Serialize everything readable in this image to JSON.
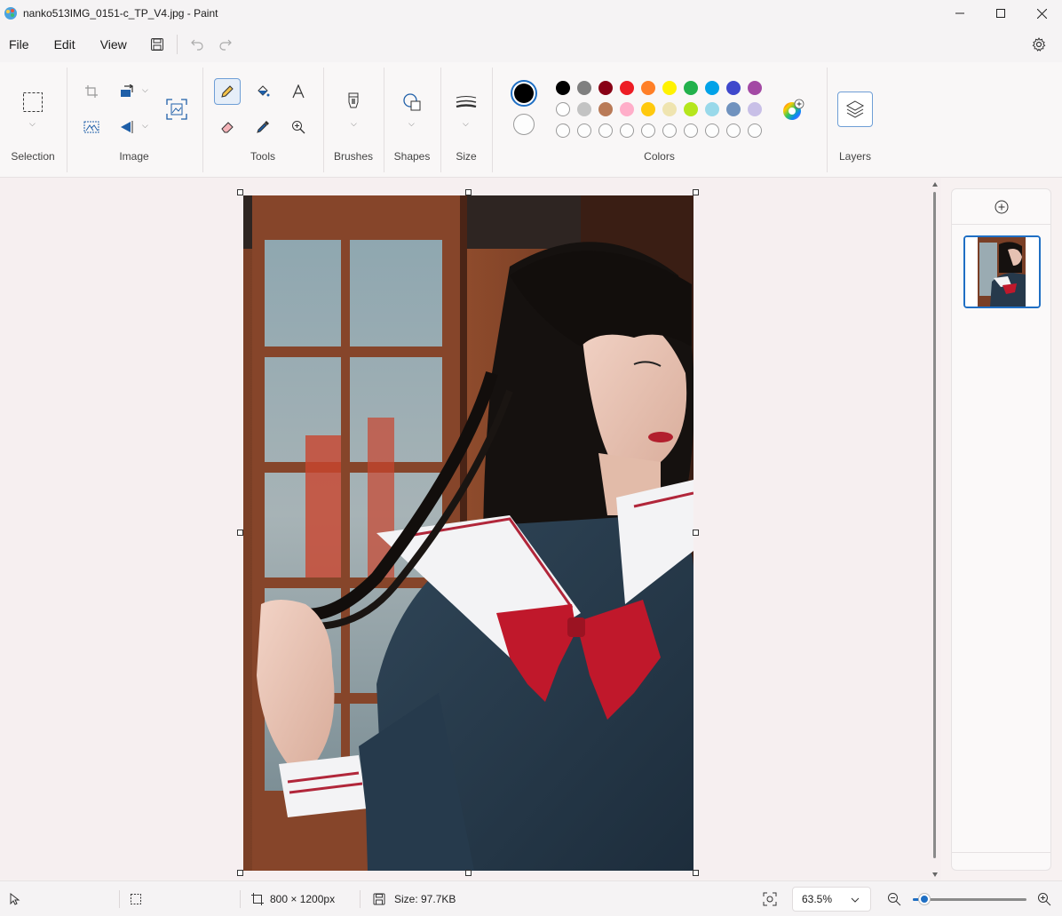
{
  "window": {
    "title": "nanko513IMG_0151-c_TP_V4.jpg - Paint"
  },
  "menu": {
    "items": [
      "File",
      "Edit",
      "View"
    ]
  },
  "ribbon": {
    "groups": {
      "selection": "Selection",
      "image": "Image",
      "tools": "Tools",
      "brushes": "Brushes",
      "shapes": "Shapes",
      "size": "Size",
      "colors": "Colors",
      "layers": "Layers"
    },
    "active_tool": "pencil-icon",
    "primary_color": "#000000",
    "secondary_color": "#ffffff",
    "palette_row1": [
      "#000000",
      "#7f7f7f",
      "#880015",
      "#ed1c24",
      "#ff7f27",
      "#fff200",
      "#22b14c",
      "#00a2e8",
      "#3f48cc",
      "#a349a4"
    ],
    "palette_row2": [
      "#ffffff",
      "#c3c3c3",
      "#b97a57",
      "#ffaec9",
      "#ffc90e",
      "#efe4b0",
      "#b5e61d",
      "#99d9ea",
      "#7092be",
      "#c8bfe7"
    ],
    "palette_row3_empty_count": 10
  },
  "status": {
    "dimensions": "800 × 1200px",
    "size": "Size: 97.7KB",
    "zoom": "63.5%",
    "zoom_slider_fraction": 0.1
  },
  "accent_color": "#1f6fc4"
}
